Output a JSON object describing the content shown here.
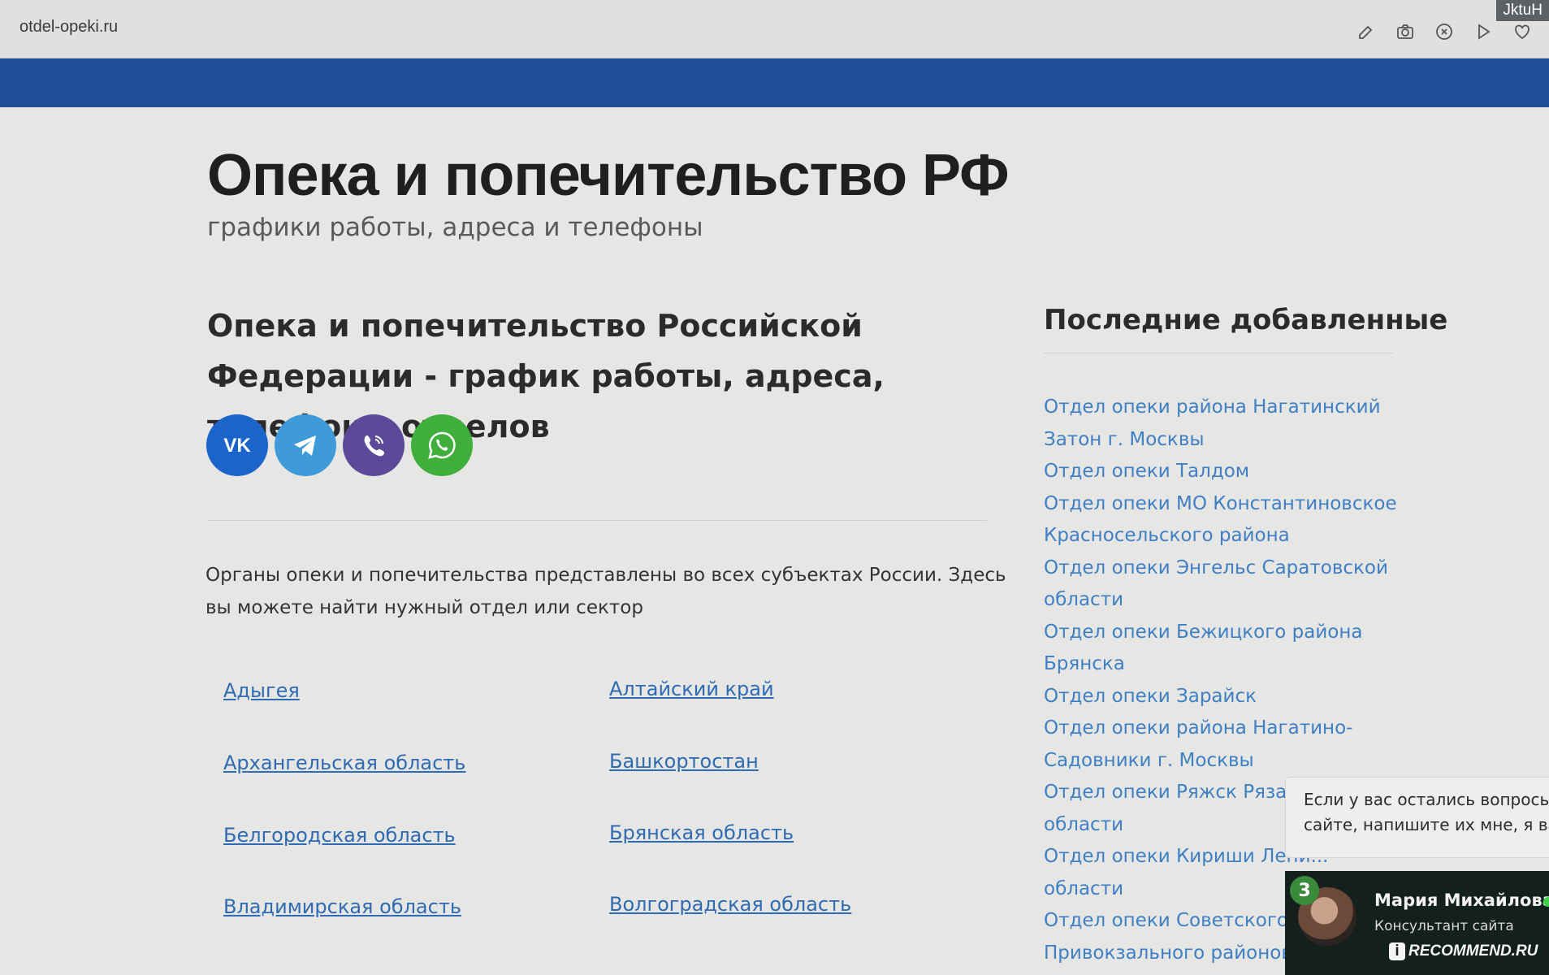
{
  "browser": {
    "url": "otdel-opeki.ru",
    "user_tag": "JktuH",
    "toolbar_icons": [
      "edit-icon",
      "camera-icon",
      "close-circle-icon",
      "play-icon",
      "heart-icon"
    ]
  },
  "header": {
    "title": "Опека и попечительство РФ",
    "subtitle": "графики работы, адреса и телефоны"
  },
  "main": {
    "heading": "Опека и попечительство Российской Федерации - график работы, адреса, телефоны отделов",
    "socials": [
      {
        "name": "vk",
        "color": "#1b64c9"
      },
      {
        "name": "telegram",
        "color": "#3f9bd8"
      },
      {
        "name": "viber",
        "color": "#5b4a9a"
      },
      {
        "name": "whatsapp",
        "color": "#3fae3a"
      }
    ],
    "intro": "Органы опеки и попечительства представлены во всех субъектах России. Здесь вы можете найти нужный отдел или сектор",
    "regions": {
      "left": [
        "Адыгея",
        "Архангельская область",
        "Белгородская область",
        "Владимирская область"
      ],
      "right": [
        "Алтайский край",
        "Башкортостан",
        "Брянская область",
        "Волгоградская область"
      ]
    }
  },
  "sidebar": {
    "heading": "Последние добавленные",
    "lines": [
      "Отдел опеки района Нагатинский",
      "Затон г. Москвы",
      "Отдел опеки Талдом",
      "Отдел опеки МО Константиновское",
      "Красносельского района",
      "Отдел опеки Энгельс Саратовской",
      "области",
      "Отдел опеки Бежицкого района",
      "Брянска",
      "Отдел опеки Зарайск",
      "Отдел опеки района Нагатино-",
      "Садовники г. Москвы",
      "Отдел опеки Ряжск Рязанс",
      "области",
      "Отдел опеки Кириши Лени...",
      "области",
      "Отдел опеки Советского и",
      "Привокзального районов"
    ]
  },
  "chat": {
    "message_line1": "Если у вас остались вопросы",
    "message_line2": "сайте, напишите их мне, я вам",
    "unread_count": "3",
    "agent_name": "Мария Михайлова",
    "agent_role": "Консультант сайта",
    "watermark": "RECOMMEND.RU",
    "online_color": "#3fcf4a"
  }
}
